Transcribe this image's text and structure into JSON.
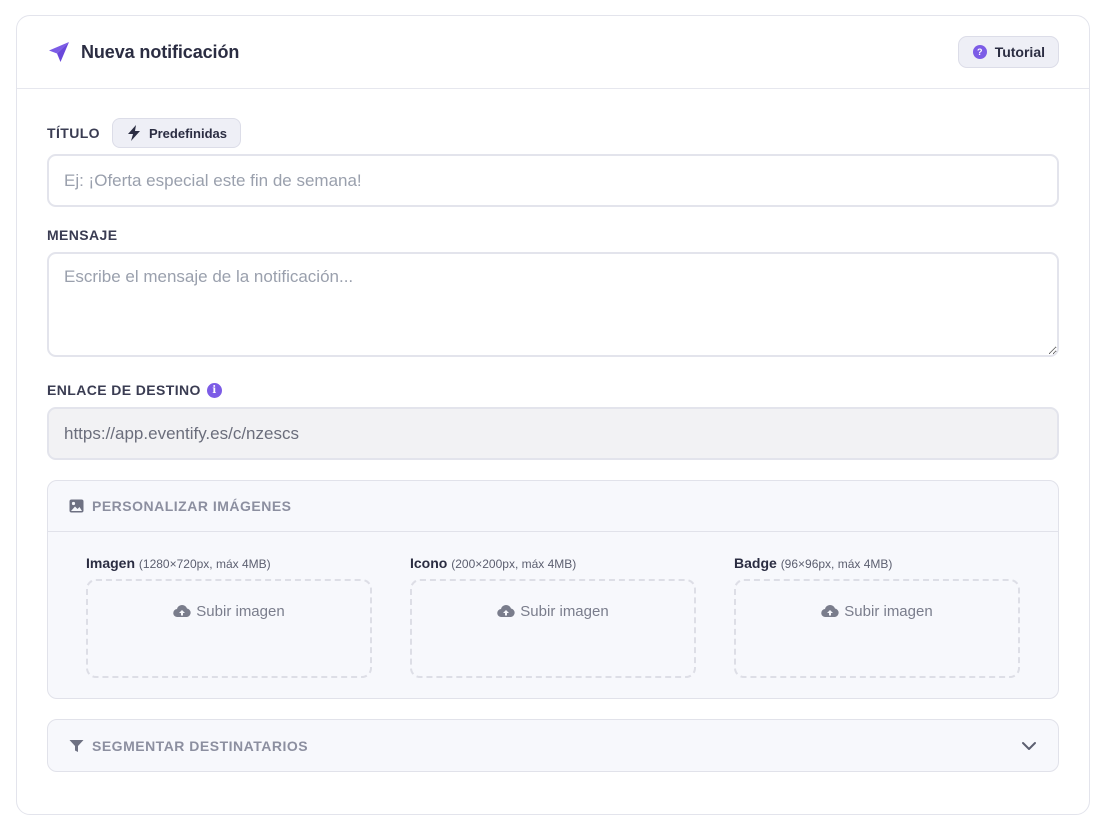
{
  "header": {
    "title": "Nueva notificación",
    "tutorial_label": "Tutorial",
    "tutorial_icon_glyph": "?"
  },
  "fields": {
    "title": {
      "label": "TÍTULO",
      "predefined_label": "Predefinidas",
      "placeholder": "Ej: ¡Oferta especial este fin de semana!",
      "value": ""
    },
    "message": {
      "label": "MENSAJE",
      "placeholder": "Escribe el mensaje de la notificación...",
      "value": ""
    },
    "link": {
      "label": "ENLACE DE DESTINO",
      "info_glyph": "i",
      "value": "https://app.eventify.es/c/nzescs"
    }
  },
  "images_panel": {
    "title": "PERSONALIZAR IMÁGENES",
    "uploads": [
      {
        "name": "Imagen",
        "dims": "(1280×720px, máx 4MB)",
        "button": "Subir imagen"
      },
      {
        "name": "Icono",
        "dims": "(200×200px, máx 4MB)",
        "button": "Subir imagen"
      },
      {
        "name": "Badge",
        "dims": "(96×96px, máx 4MB)",
        "button": "Subir imagen"
      }
    ]
  },
  "segment_panel": {
    "title": "SEGMENTAR DESTINATARIOS"
  },
  "colors": {
    "accent": "#7c5ce6",
    "text": "#2b2d42",
    "muted": "#8c8fa0",
    "border": "#e3e4ec"
  }
}
